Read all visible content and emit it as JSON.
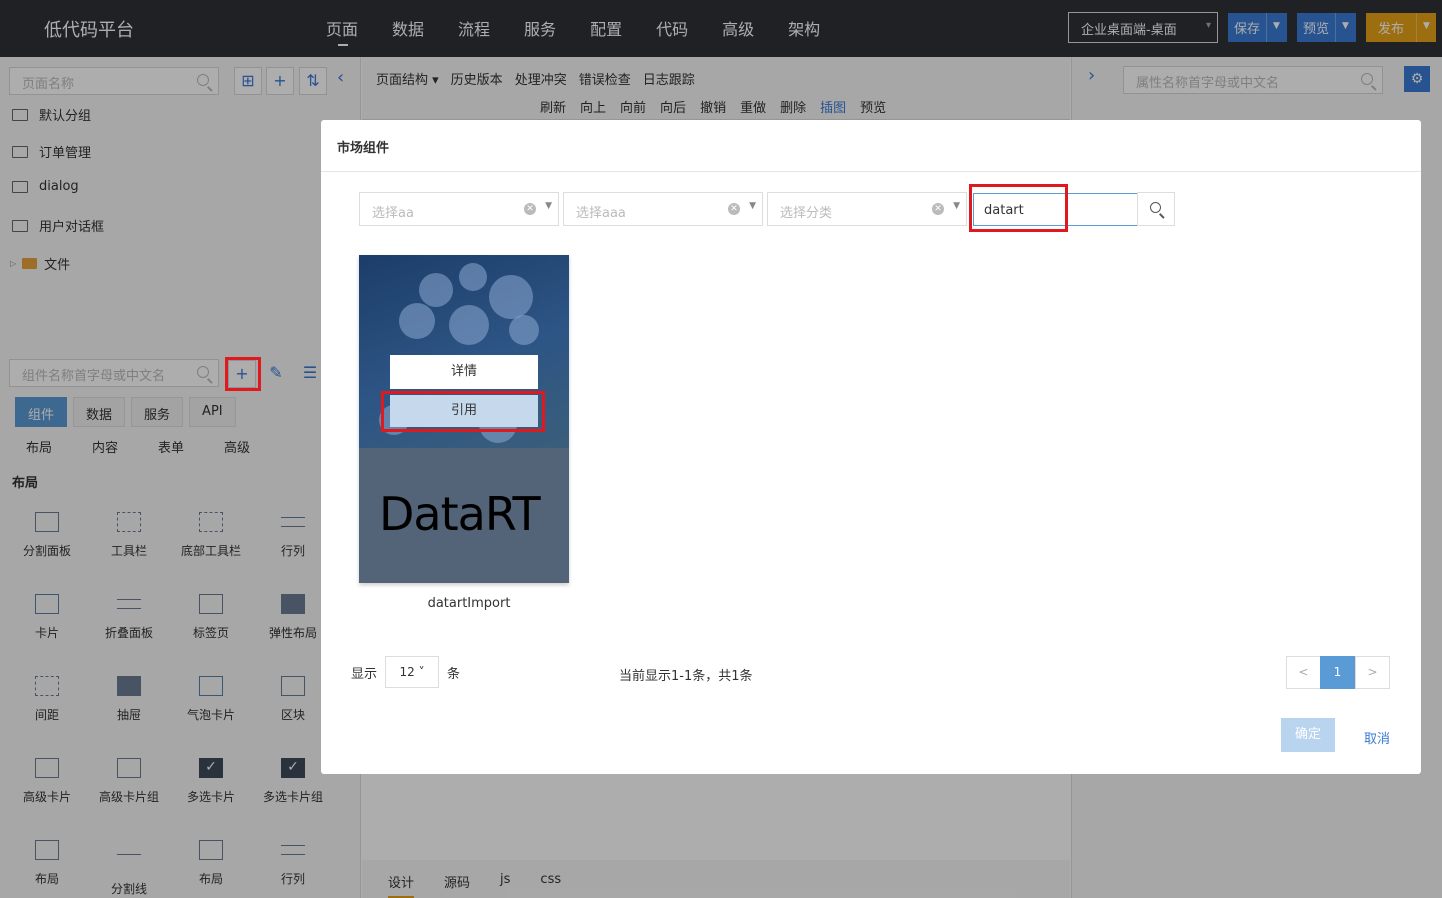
{
  "header": {
    "brand": "低代码平台",
    "nav": [
      "页面",
      "数据",
      "流程",
      "服务",
      "配置",
      "代码",
      "高级",
      "架构"
    ],
    "env": "企业桌面端-桌面",
    "save": "保存",
    "preview": "预览",
    "publish": "发布"
  },
  "left": {
    "page_search_placeholder": "页面名称",
    "groups": [
      "默认分组",
      "订单管理",
      "dialog",
      "用户对话框"
    ],
    "file": "文件",
    "comp_search_placeholder": "组件名称首字母或中文名",
    "tabs": [
      "组件",
      "数据",
      "服务",
      "API"
    ],
    "subtabs": [
      "布局",
      "内容",
      "表单",
      "高级"
    ],
    "section": "布局",
    "components": [
      "分割面板",
      "工具栏",
      "底部工具栏",
      "行列",
      "卡片",
      "折叠面板",
      "标签页",
      "弹性布局",
      "间距",
      "抽屉",
      "气泡卡片",
      "区块",
      "高级卡片",
      "高级卡片组",
      "多选卡片",
      "多选卡片组",
      "布局",
      "分割线",
      "布局",
      "行列"
    ]
  },
  "center": {
    "menu": [
      "页面结构 ▾",
      "历史版本",
      "处理冲突",
      "错误检查",
      "日志跟踪"
    ],
    "actions": [
      "刷新",
      "向上",
      "向前",
      "向后",
      "撤销",
      "重做",
      "删除",
      "插图",
      "预览"
    ],
    "bottom_tabs": [
      "设计",
      "源码",
      "js",
      "css"
    ]
  },
  "right": {
    "search_placeholder": "属性名称首字母或中文名"
  },
  "modal": {
    "title": "市场组件",
    "filter1": "选择aa",
    "filter2": "选择aaa",
    "filter3": "选择分类",
    "keyword": "datart",
    "card": {
      "detail": "详情",
      "cite": "引用",
      "logo": "DataRT",
      "name": "datartImport"
    },
    "show_label": "显示",
    "page_size": "12",
    "unit": "条",
    "info": "当前显示1-1条，共1条",
    "prev": "<",
    "page": "1",
    "next": ">",
    "ok": "确定",
    "cancel": "取消"
  },
  "colors": {
    "topbar": "#2e3136",
    "primary": "#3a7bd5",
    "publish": "#e8a317",
    "highlight": "#e0191f"
  }
}
